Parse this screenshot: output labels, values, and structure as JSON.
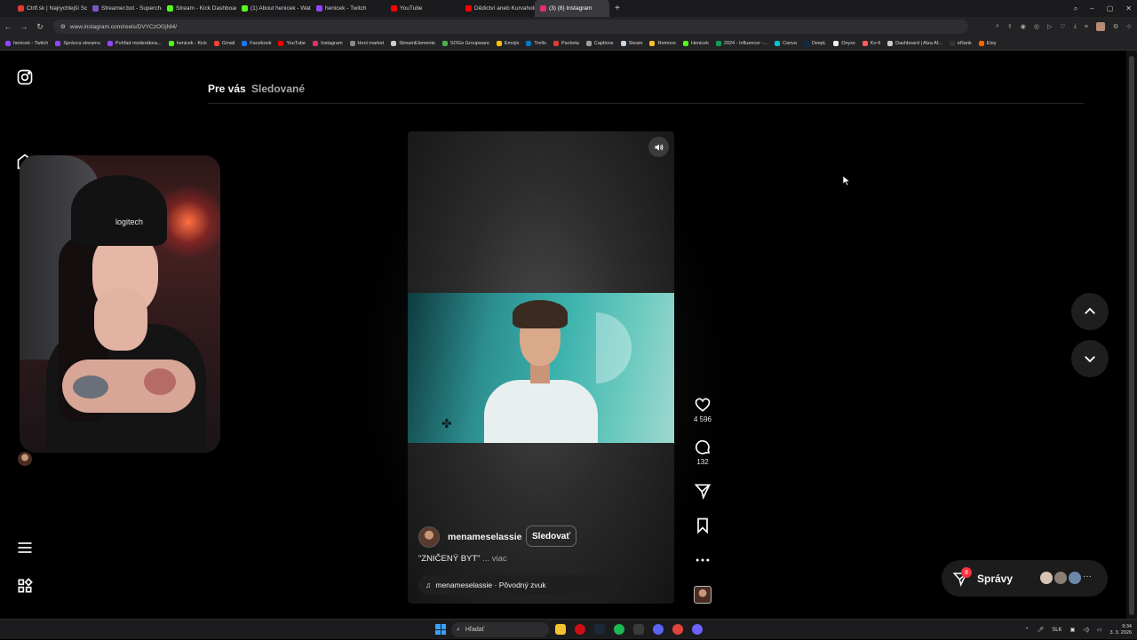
{
  "browser": {
    "tabs": [
      {
        "label": "Ctrlf.sk | Najrychlejší Sc...",
        "color": "#e53935"
      },
      {
        "label": "Streamer.bot - Superchar...",
        "color": "#7e57c2"
      },
      {
        "label": "Stream - Kick Dashboard",
        "color": "#53fc18"
      },
      {
        "label": "(1) About henicek - Watc...",
        "color": "#53fc18"
      },
      {
        "label": "henicek - Twitch",
        "color": "#9146ff"
      },
      {
        "label": "YouTube",
        "color": "#ff0000"
      },
      {
        "label": "Dědictví aneb Kurvaholis...",
        "color": "#ff0000"
      },
      {
        "label": "(3) (8) Instagram",
        "color": "#e1306c",
        "active": true
      }
    ],
    "new_tab": "+",
    "url": "www.instagram.com/reels/DVYCzOGjNl4/",
    "bookmarks": [
      {
        "label": "henicek - Twitch",
        "color": "#9146ff"
      },
      {
        "label": "Správca streamu",
        "color": "#9146ff"
      },
      {
        "label": "Pohľad moderátora...",
        "color": "#9146ff"
      },
      {
        "label": "henicek - Kick",
        "color": "#53fc18"
      },
      {
        "label": "Gmail",
        "color": "#ea4335"
      },
      {
        "label": "Facebook",
        "color": "#1877f2"
      },
      {
        "label": "YouTube",
        "color": "#ff0000"
      },
      {
        "label": "Instagram",
        "color": "#e1306c"
      },
      {
        "label": "Heni market",
        "color": "#888888"
      },
      {
        "label": "StreamElements",
        "color": "#cccccc"
      },
      {
        "label": "SOGo Groupware",
        "color": "#4caf50"
      },
      {
        "label": "Emojis",
        "color": "#ffc107"
      },
      {
        "label": "Trello",
        "color": "#0079bf"
      },
      {
        "label": "Packeta",
        "color": "#e53935"
      },
      {
        "label": "Captions",
        "color": "#9e9e9e"
      },
      {
        "label": "Steam",
        "color": "#c7d5e0"
      },
      {
        "label": "Remove",
        "color": "#fbc02d"
      },
      {
        "label": "Henicek",
        "color": "#53fc18"
      },
      {
        "label": "2024 - Influencer -...",
        "color": "#0f9d58"
      },
      {
        "label": "Canva",
        "color": "#00c4cc"
      },
      {
        "label": "DeepL",
        "color": "#0f2b46"
      },
      {
        "label": "Onyxx",
        "color": "#eeeeee"
      },
      {
        "label": "Ko-fi",
        "color": "#ff5e5b"
      },
      {
        "label": "Dashboard | Alza Af...",
        "color": "#cccccc"
      },
      {
        "label": "eRank",
        "color": "#333333"
      },
      {
        "label": "Etsy",
        "color": "#f56400"
      }
    ]
  },
  "instagram": {
    "feed_tabs": {
      "for_you": "Pre vás",
      "following": "Sledované"
    },
    "reel": {
      "author": "menameselassie",
      "follow_label": "Sledovať",
      "caption": "\"ZNIČENÝ BYT\"",
      "caption_more": "... viac",
      "audio": "menameselassie · Pôvodný zvuk",
      "likes": "4 596",
      "comments": "132"
    },
    "messages": {
      "label": "Správy",
      "badge": "8"
    }
  },
  "taskbar": {
    "search_placeholder": "Hľadať",
    "language": "SLK",
    "time": "9:34",
    "date": "3. 3. 2026"
  },
  "colors": {
    "accent_red": "#ff3040",
    "windows_blue": "#3aa0ff"
  }
}
